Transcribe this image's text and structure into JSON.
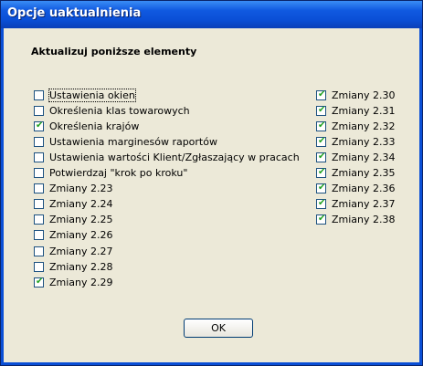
{
  "window": {
    "title": "Opcje uaktualnienia"
  },
  "heading": "Aktualizuj poniższe elementy",
  "left_items": [
    {
      "label": "Ustawienia okien",
      "checked": false
    },
    {
      "label": "Określenia klas towarowych",
      "checked": false
    },
    {
      "label": "Określenia krajów",
      "checked": true
    },
    {
      "label": "Ustawienia marginesów raportów",
      "checked": false
    },
    {
      "label": "Ustawienia wartości Klient/Zgłaszający w pracach",
      "checked": false
    },
    {
      "label": "Potwierdzaj \"krok po kroku\"",
      "checked": false
    },
    {
      "label": "Zmiany 2.23",
      "checked": false
    },
    {
      "label": "Zmiany 2.24",
      "checked": false
    },
    {
      "label": "Zmiany 2.25",
      "checked": false
    },
    {
      "label": "Zmiany 2.26",
      "checked": false
    },
    {
      "label": "Zmiany 2.27",
      "checked": false
    },
    {
      "label": "Zmiany 2.28",
      "checked": false
    },
    {
      "label": "Zmiany 2.29",
      "checked": true
    }
  ],
  "right_items": [
    {
      "label": "Zmiany 2.30",
      "checked": true
    },
    {
      "label": "Zmiany 2.31",
      "checked": true
    },
    {
      "label": "Zmiany 2.32",
      "checked": true
    },
    {
      "label": "Zmiany 2.33",
      "checked": true
    },
    {
      "label": "Zmiany 2.34",
      "checked": true
    },
    {
      "label": "Zmiany 2.35",
      "checked": true
    },
    {
      "label": "Zmiany 2.36",
      "checked": true
    },
    {
      "label": "Zmiany 2.37",
      "checked": true
    },
    {
      "label": "Zmiany 2.38",
      "checked": true
    }
  ],
  "buttons": {
    "ok_label": "OK"
  },
  "colors": {
    "titlebar": "#0a4fd6",
    "face": "#ece9d8",
    "check": "#21a121"
  },
  "icons": {
    "check": "checkmark-icon"
  }
}
